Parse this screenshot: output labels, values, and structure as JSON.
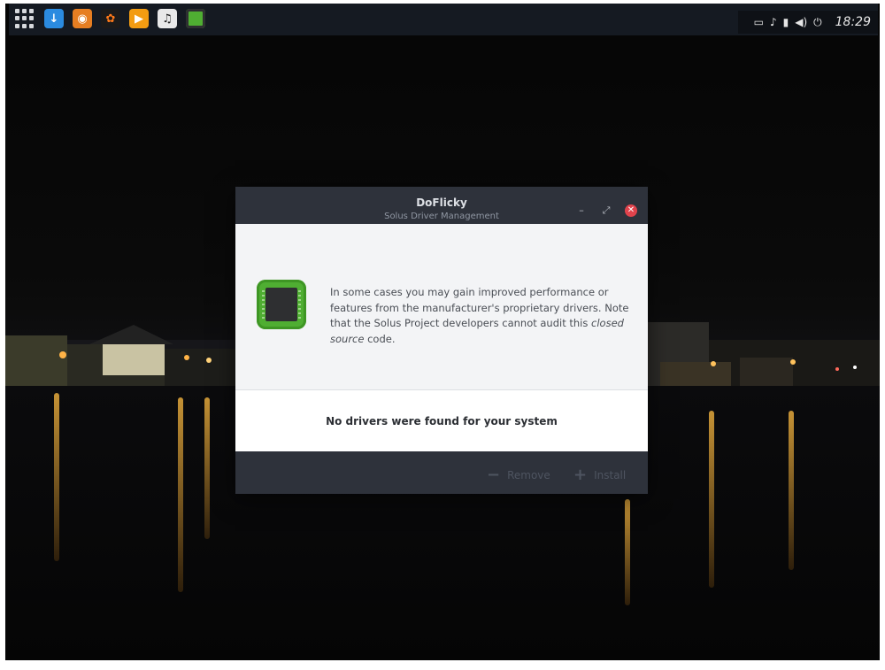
{
  "panel": {
    "launchers": [
      {
        "name": "downloader",
        "icon": "download-arrow-icon",
        "color": "#2b8be0"
      },
      {
        "name": "app-orange",
        "icon": "orange-app-icon",
        "color": "#e67e22"
      },
      {
        "name": "app-dark",
        "icon": "media-icon",
        "color": "#e65c00"
      },
      {
        "name": "video-player",
        "icon": "play-icon",
        "color": "#f39c12"
      },
      {
        "name": "music-player",
        "icon": "music-icon",
        "color": "#e9e9e9"
      },
      {
        "name": "driver-manager",
        "icon": "chip-icon",
        "color": "#4fae32"
      }
    ],
    "clock": "18:29"
  },
  "dialog": {
    "title": "DoFlicky",
    "subtitle": "Solus Driver Management",
    "note_part1": "In some cases you may gain improved performance or features from the manufacturer's proprietary drivers. Note that the Solus Project developers cannot audit this",
    "note_italic": "closed source",
    "note_part2": "code.",
    "status": "No drivers were found for your system",
    "remove_label": "Remove",
    "install_label": "Install"
  }
}
